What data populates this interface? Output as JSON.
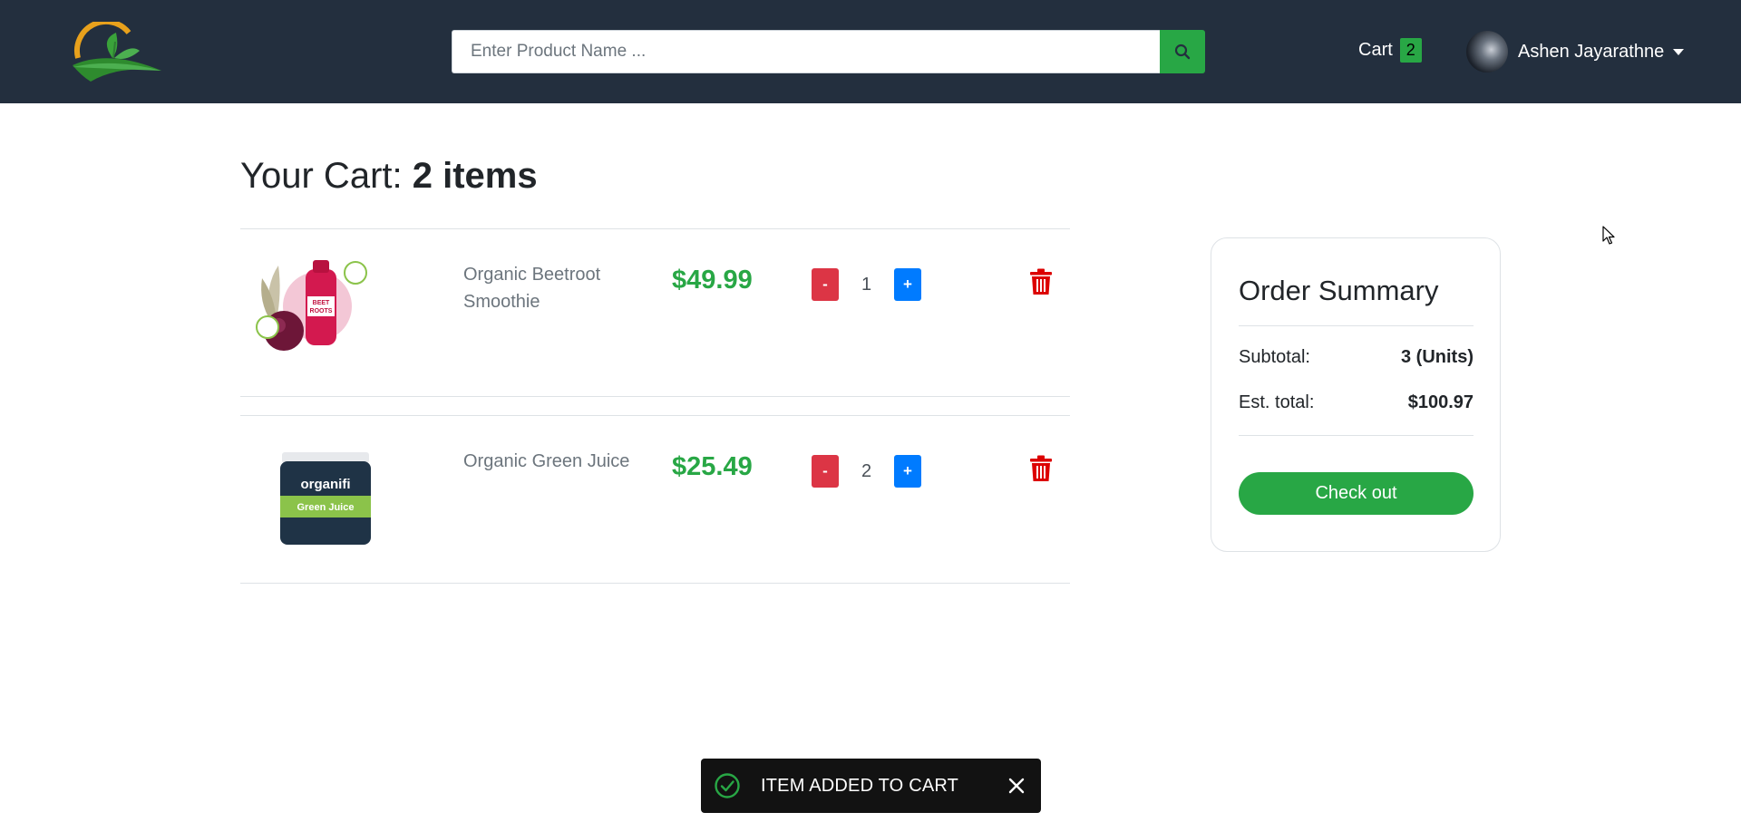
{
  "header": {
    "search": {
      "placeholder": "Enter Product Name ...",
      "value": ""
    },
    "cart": {
      "label": "Cart",
      "count": "2"
    },
    "user": {
      "name": "Ashen Jayarathne"
    }
  },
  "cart": {
    "title_prefix": "Your Cart:",
    "title_count": "2 items",
    "items": [
      {
        "name": "Organic Beetroot Smoothie",
        "price": "$49.99",
        "quantity": "1",
        "minus_label": "-",
        "plus_label": "+",
        "image_label": "BEET ROOTS"
      },
      {
        "name": "Organic Green Juice",
        "price": "$25.49",
        "quantity": "2",
        "minus_label": "-",
        "plus_label": "+",
        "image_label": "organifi"
      }
    ]
  },
  "summary": {
    "title": "Order Summary",
    "subtotal_label": "Subtotal:",
    "subtotal_value": "3 (Units)",
    "total_label": "Est. total:",
    "total_value": "$100.97",
    "checkout_label": "Check out"
  },
  "toast": {
    "message": "ITEM ADDED TO CART"
  },
  "colors": {
    "navbar": "#232f3e",
    "accent_green": "#28a745",
    "danger": "#dc3545",
    "primary": "#007bff"
  }
}
